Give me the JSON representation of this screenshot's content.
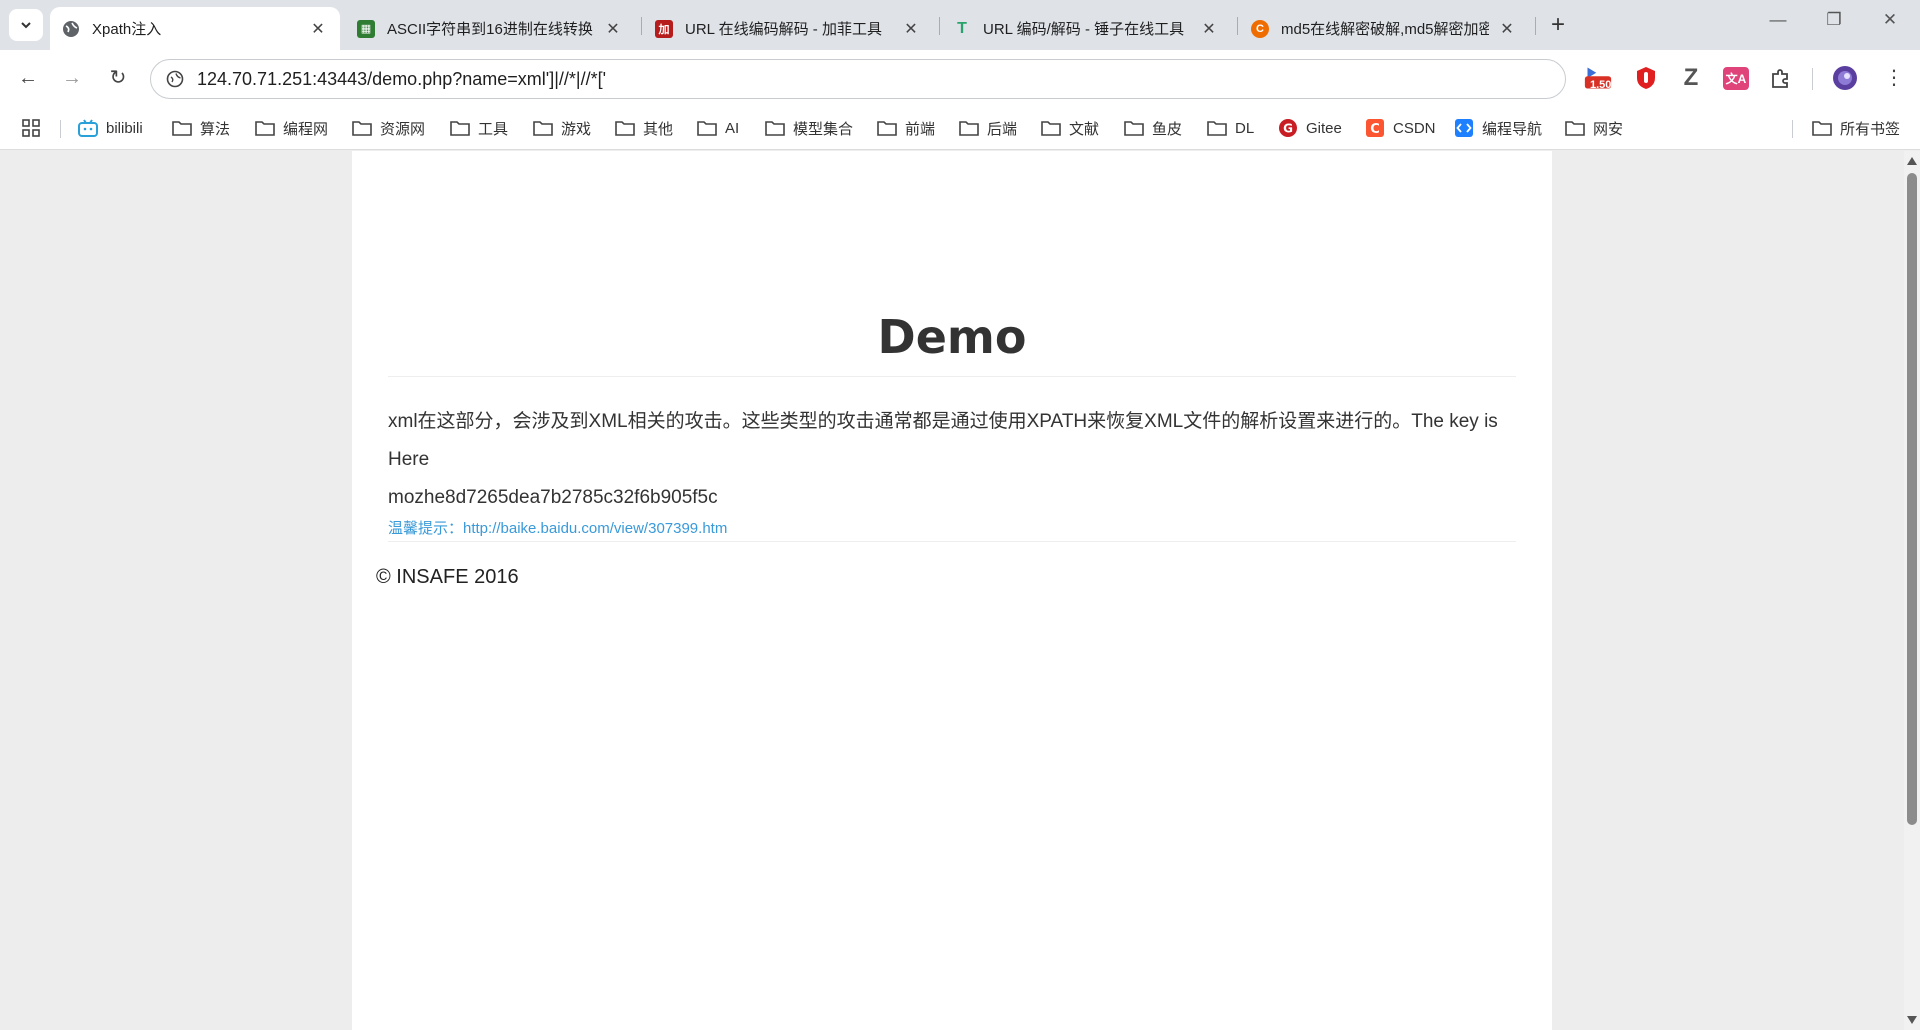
{
  "tabs": [
    {
      "title": "Xpath注入",
      "close": "✕",
      "icon": "globe-icon"
    },
    {
      "title": "ASCII字符串到16进制在线转换",
      "close": "✕",
      "icon": "spreadsheet-icon"
    },
    {
      "title": "URL 在线编码解码 - 加菲工具",
      "close": "✕",
      "icon": "jiafei-icon"
    },
    {
      "title": "URL 编码/解码 - 锤子在线工具",
      "close": "✕",
      "icon": "hammer-icon"
    },
    {
      "title": "md5在线解密破解,md5解密加密",
      "close": "✕",
      "icon": "cmd5-icon"
    }
  ],
  "new_tab": "+",
  "window_controls": {
    "minimize": "—",
    "restore": "❐",
    "close": "✕"
  },
  "nav": {
    "back": "←",
    "forward": "→",
    "reload": "↻"
  },
  "omnibox": {
    "url": "124.70.71.251:43443/demo.php?name=xml']|//*|//*['"
  },
  "extensions": [
    {
      "name": "speed-badge",
      "text": "1.50",
      "color": "#d93025"
    },
    {
      "name": "adblock",
      "text": "",
      "color": "#e02020"
    },
    {
      "name": "zotero",
      "text": "Z",
      "color": "#555555"
    },
    {
      "name": "translate",
      "text": "文A",
      "color": "#e0437a"
    },
    {
      "name": "extensions-puzzle",
      "text": "",
      "color": "#444444"
    }
  ],
  "menu": "⋮",
  "bookmarks": [
    {
      "label": "bilibili",
      "icon": "bilibili-icon"
    },
    {
      "label": "算法",
      "icon": "folder-icon"
    },
    {
      "label": "编程网",
      "icon": "folder-icon"
    },
    {
      "label": "资源网",
      "icon": "folder-icon"
    },
    {
      "label": "工具",
      "icon": "folder-icon"
    },
    {
      "label": "游戏",
      "icon": "folder-icon"
    },
    {
      "label": "其他",
      "icon": "folder-icon"
    },
    {
      "label": "AI",
      "icon": "folder-icon"
    },
    {
      "label": "模型集合",
      "icon": "folder-icon"
    },
    {
      "label": "前端",
      "icon": "folder-icon"
    },
    {
      "label": "后端",
      "icon": "folder-icon"
    },
    {
      "label": "文献",
      "icon": "folder-icon"
    },
    {
      "label": "鱼皮",
      "icon": "folder-icon"
    },
    {
      "label": "DL",
      "icon": "folder-icon"
    },
    {
      "label": "Gitee",
      "icon": "gitee-icon"
    },
    {
      "label": "CSDN",
      "icon": "csdn-icon"
    },
    {
      "label": "编程导航",
      "icon": "code-nav-icon"
    },
    {
      "label": "网安",
      "icon": "folder-icon"
    }
  ],
  "all_bookmarks": "所有书签",
  "page": {
    "title": "Demo",
    "content_line1": "xml在这部分，会涉及到XML相关的攻击。这些类型的攻击通常都是通过使用XPATH来恢复XML文件的解析设置来进行的。The key is Here",
    "content_line2": "mozhe8d7265dea7b2785c32f6b905f5c",
    "tip": "温馨提示：http://baike.baidu.com/view/307399.htm",
    "footer": "© INSAFE 2016"
  }
}
